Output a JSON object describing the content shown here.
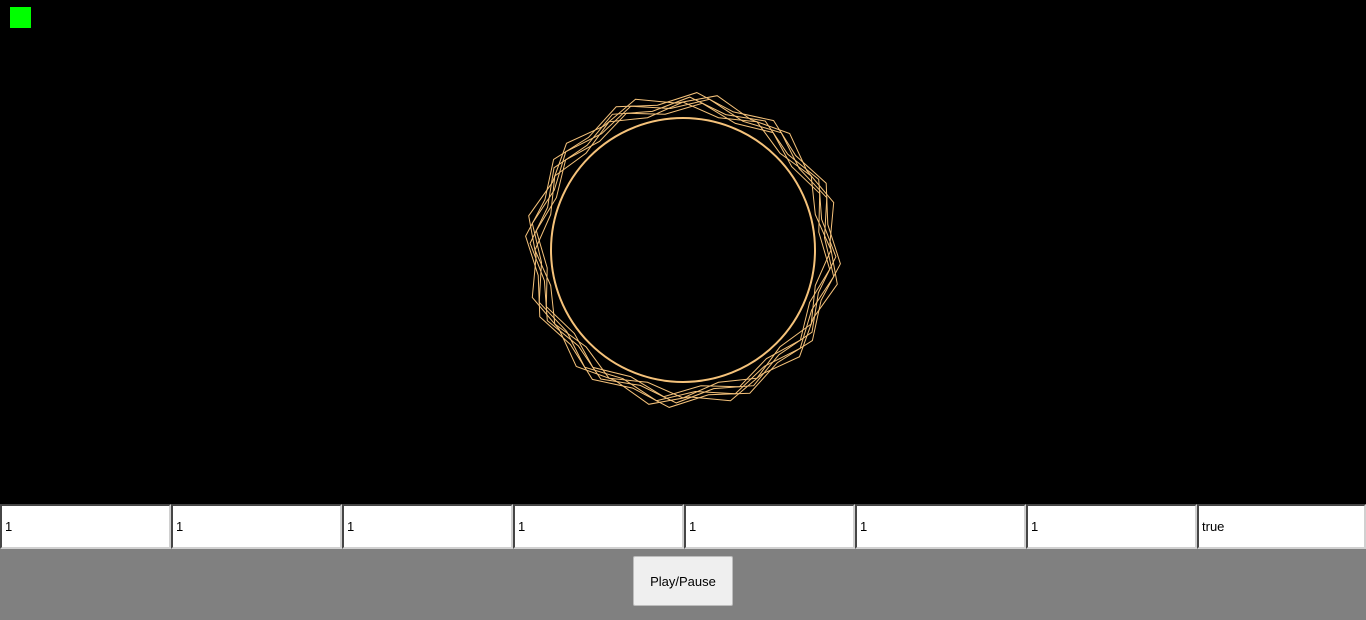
{
  "indicator": {
    "color": "#00ff00"
  },
  "drawing": {
    "stroke_color": "#f5c27a",
    "background": "#000000"
  },
  "inputs": [
    {
      "value": "1"
    },
    {
      "value": "1"
    },
    {
      "value": "1"
    },
    {
      "value": "1"
    },
    {
      "value": "1"
    },
    {
      "value": "1"
    },
    {
      "value": "1"
    },
    {
      "value": "true"
    }
  ],
  "controls": {
    "play_pause_label": "Play/Pause"
  }
}
